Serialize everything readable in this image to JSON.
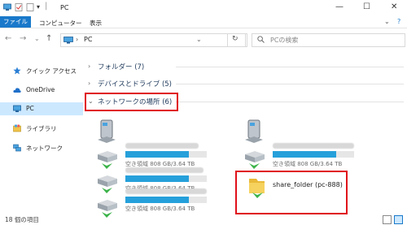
{
  "window": {
    "title": "PC",
    "minimize": "—",
    "maximize": "☐",
    "close": "✕"
  },
  "ribbon": {
    "tabs": [
      "ファイル",
      "コンピューター",
      "表示"
    ],
    "expand": "⌄",
    "help": "?"
  },
  "address": {
    "back": "←",
    "forward": "→",
    "recent": "⌄",
    "up": "↑",
    "separator": "›",
    "path": "PC",
    "dropdown": "⌄",
    "refresh": "↻",
    "search_placeholder": "PCの検索",
    "search_icon": "search-icon"
  },
  "nav": {
    "items": [
      {
        "label": "クイック アクセス",
        "icon": "star-icon"
      },
      {
        "label": "OneDrive",
        "icon": "cloud-icon"
      },
      {
        "label": "PC",
        "icon": "computer-icon",
        "selected": true
      },
      {
        "label": "ライブラリ",
        "icon": "library-icon"
      },
      {
        "label": "ネットワーク",
        "icon": "network-icon"
      }
    ]
  },
  "groups": {
    "folders": {
      "label": "フォルダー (7)",
      "chevron": "›"
    },
    "devices": {
      "label": "デバイスとドライブ (5)",
      "chevron": "›"
    },
    "network": {
      "label": "ネットワークの場所 (6)",
      "chevron": "⌄"
    }
  },
  "network_locations": [
    {
      "free_text": "空き領域 808 GB/3.64 TB",
      "used_fraction": 0.78
    },
    {
      "free_text": "空き領域 808 GB/3.64 TB",
      "used_fraction": 0.78
    },
    {
      "free_text": "空き領域 808 GB/3.64 TB",
      "used_fraction": 0.78
    },
    {
      "free_text": "空き領域 808 GB/3.64 TB",
      "used_fraction": 0.78
    },
    {
      "name": "share_folder (pc-888)"
    }
  ],
  "status": {
    "text": "18 個の項目"
  },
  "colors": {
    "accent": "#1979ca",
    "highlight": "#e0101a",
    "bar": "#26a0da",
    "selected": "#cce8ff"
  }
}
